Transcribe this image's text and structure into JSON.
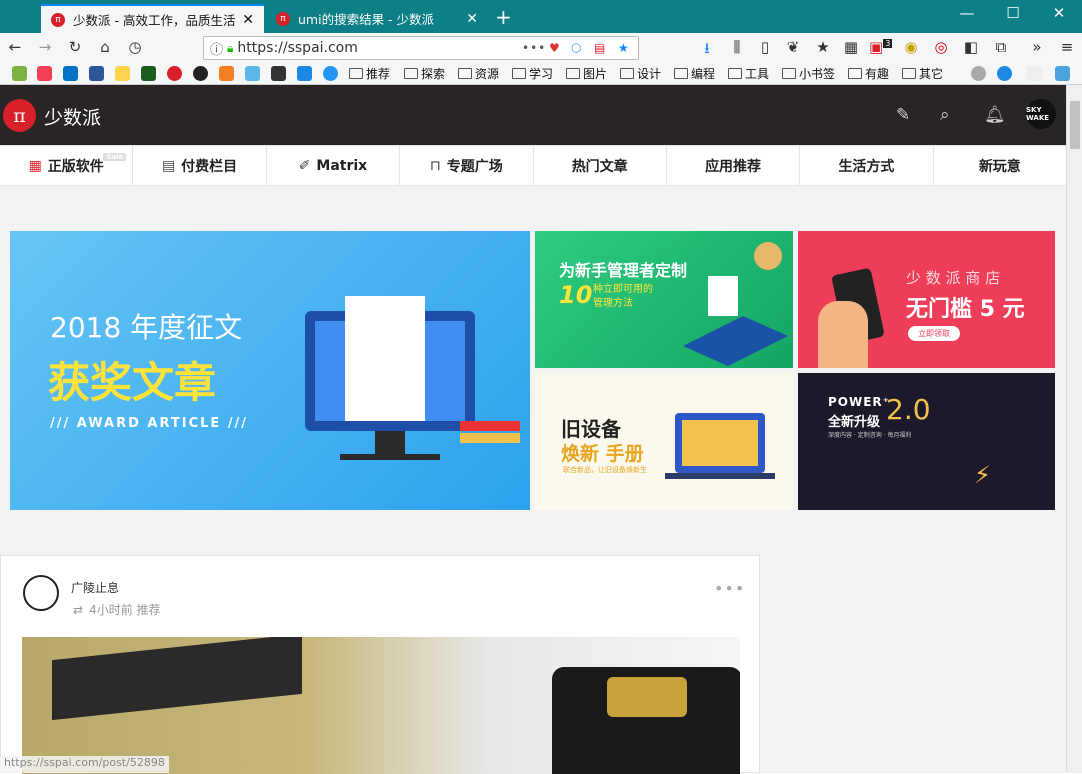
{
  "browser": {
    "tabs": [
      {
        "title": "少数派 - 高效工作，品质生活"
      },
      {
        "title": "umi的搜索结果 - 少数派"
      }
    ],
    "url": "https://sspai.com",
    "bookmarks": [
      "推荐",
      "探索",
      "资源",
      "学习",
      "图片",
      "设计",
      "编程",
      "工具",
      "小书签",
      "有趣",
      "其它"
    ],
    "badge_count": "3",
    "status_url": "https://sspai.com/post/52898"
  },
  "site": {
    "logo_text": "少数派",
    "avatar_text": "SKY\nWAKE",
    "nav": [
      {
        "label": "正版软件",
        "tag": "Sale"
      },
      {
        "label": "付费栏目"
      },
      {
        "label": "Matrix"
      },
      {
        "label": "专题广场"
      },
      {
        "label": "热门文章"
      },
      {
        "label": "应用推荐"
      },
      {
        "label": "生活方式"
      },
      {
        "label": "新玩意"
      }
    ]
  },
  "banners": {
    "main": {
      "year": "2018 年度征文",
      "title": "获奖文章",
      "sub": "/// AWARD ARTICLE ///"
    },
    "b2": {
      "title": "为新手管理者定制",
      "sub1": "10",
      "sub2": "种立即可用的\n管理方法"
    },
    "b3": {
      "shop": "少 数 派 商 店",
      "title": "无门槛 5 元",
      "btn": "立即领取"
    },
    "b4": {
      "line1": "旧设备",
      "line2": "焕新 手册",
      "sub": "联合新品，让旧设备焕新生"
    },
    "b5": {
      "line1": "POWER⁺",
      "line2": "全新升级",
      "ver": "2.0",
      "sub": "深度内容 · 定制咨询 · 每月福利"
    }
  },
  "feed": {
    "author": "广陵止息",
    "meta": "4小时前 推荐"
  },
  "colors": {
    "tabbar": "#0d7f86",
    "brand": "#d8202a",
    "header": "#292525"
  }
}
